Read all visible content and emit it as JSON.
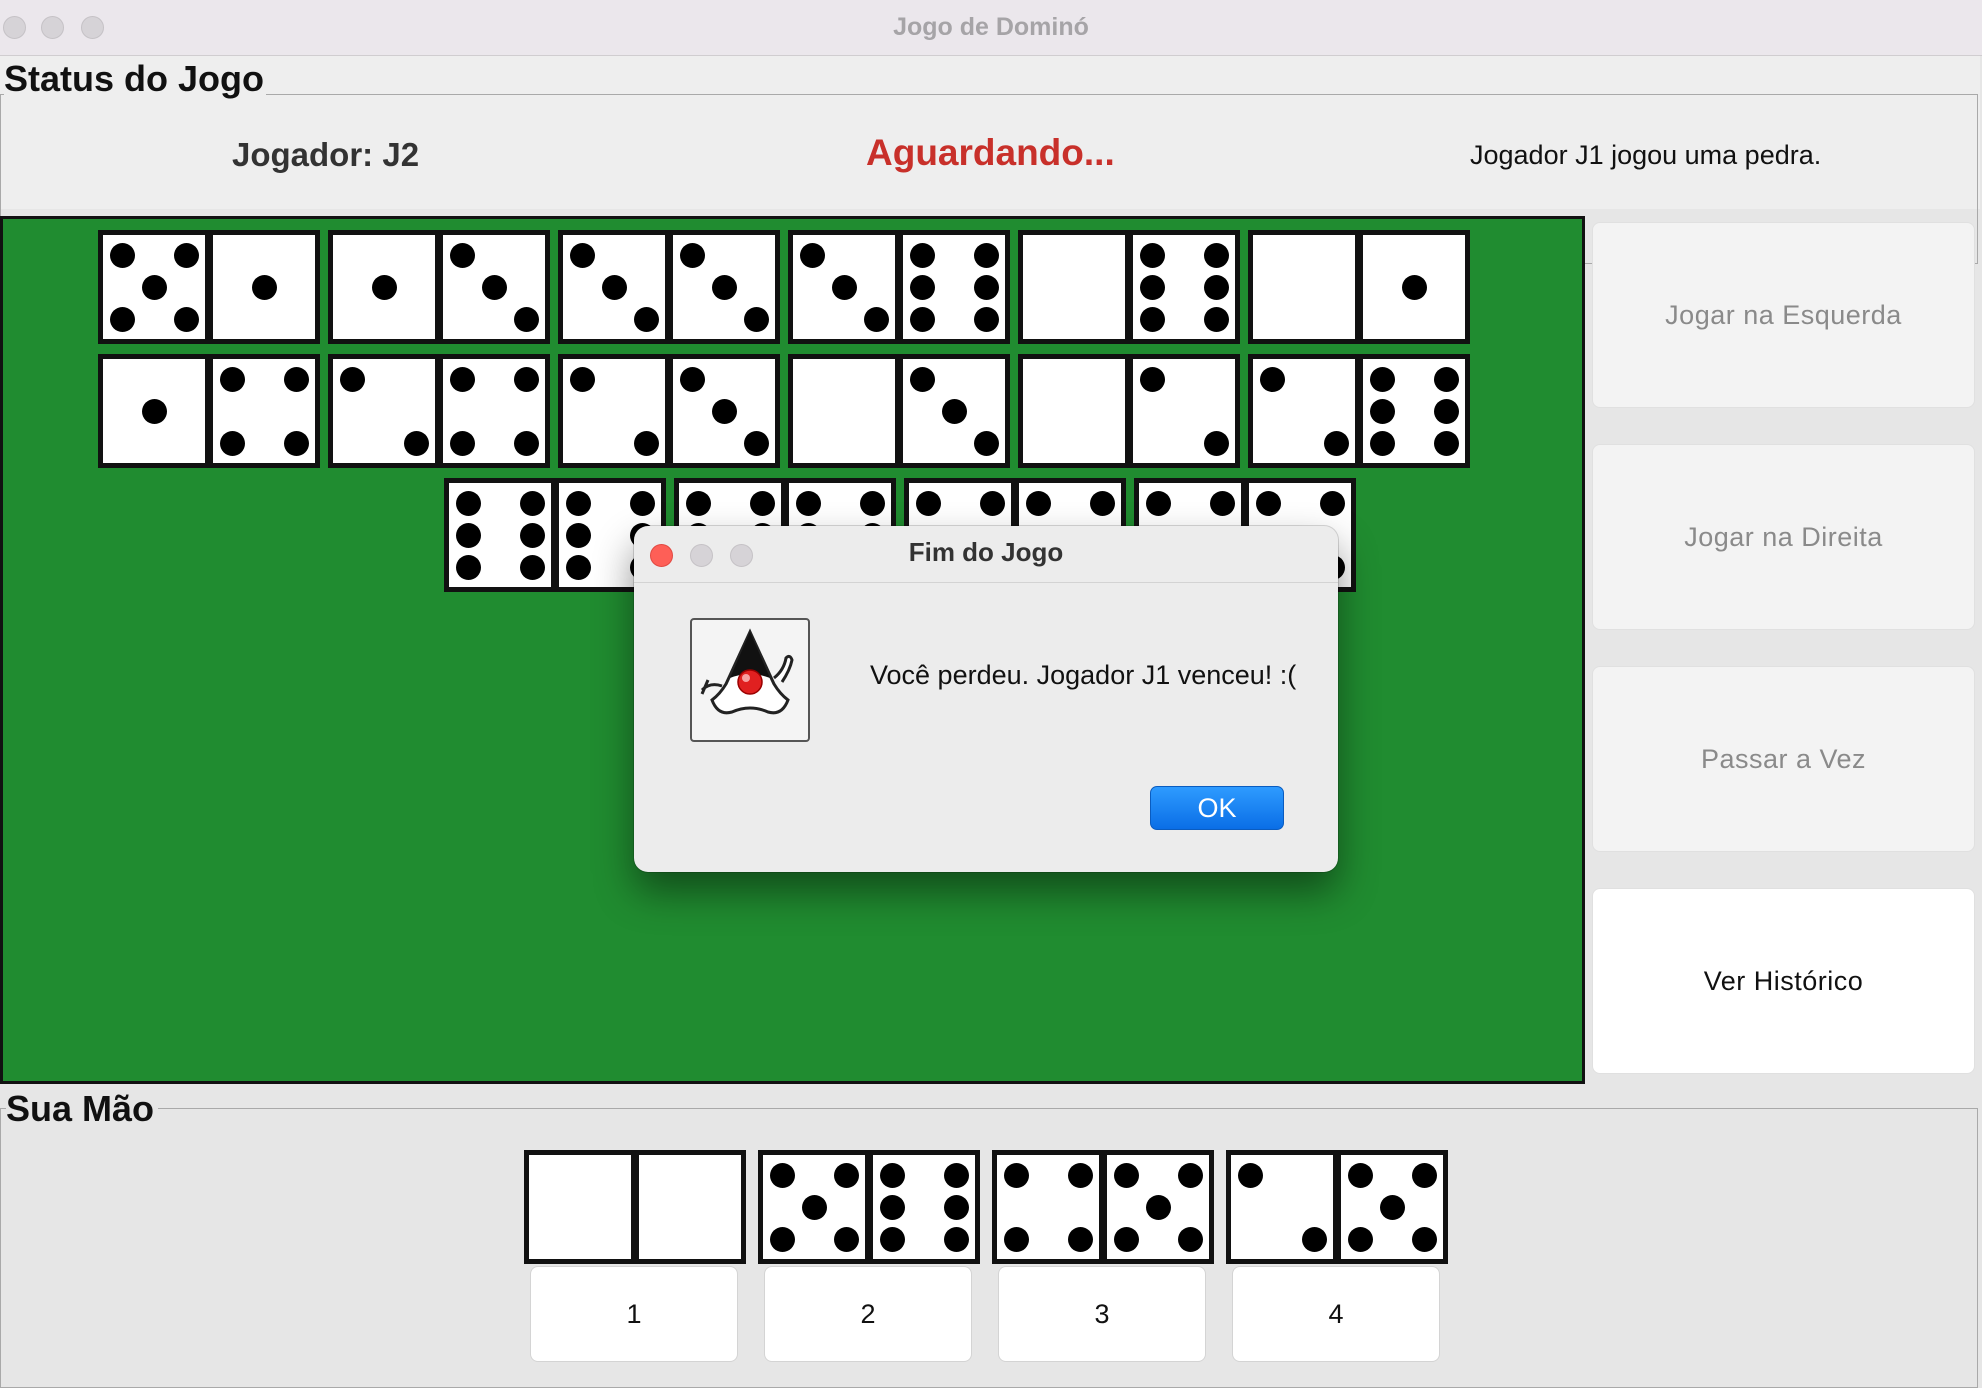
{
  "window": {
    "title": "Jogo de Dominó"
  },
  "status": {
    "legend": "Status do Jogo",
    "player": "Jogador: J2",
    "state": "Aguardando...",
    "last_action": "Jogador J1 jogou uma pedra.",
    "state_color": "#c8302a"
  },
  "board": {
    "background_color": "#208c30",
    "rows": [
      [
        [
          5,
          1
        ],
        [
          1,
          3
        ],
        [
          3,
          3
        ],
        [
          3,
          6
        ],
        [
          0,
          6
        ],
        [
          0,
          1
        ]
      ],
      [
        [
          1,
          4
        ],
        [
          2,
          4
        ],
        [
          2,
          3
        ],
        [
          0,
          3
        ],
        [
          0,
          2
        ],
        [
          2,
          6
        ]
      ],
      [
        [
          6,
          6
        ],
        [
          6,
          6
        ],
        [
          4,
          4
        ],
        [
          4,
          4
        ]
      ]
    ]
  },
  "actions": {
    "play_left": "Jogar na Esquerda",
    "play_right": "Jogar na Direita",
    "pass": "Passar a Vez",
    "history": "Ver Histórico"
  },
  "hand": {
    "legend": "Sua Mão",
    "tiles": [
      [
        0,
        0
      ],
      [
        5,
        6
      ],
      [
        4,
        5
      ],
      [
        2,
        5
      ]
    ],
    "buttons": [
      "1",
      "2",
      "3",
      "4"
    ]
  },
  "dialog": {
    "title": "Fim do Jogo",
    "message": "Você perdeu. Jogador J1 venceu! :(",
    "ok_label": "OK",
    "icon": "java-duke-icon"
  }
}
